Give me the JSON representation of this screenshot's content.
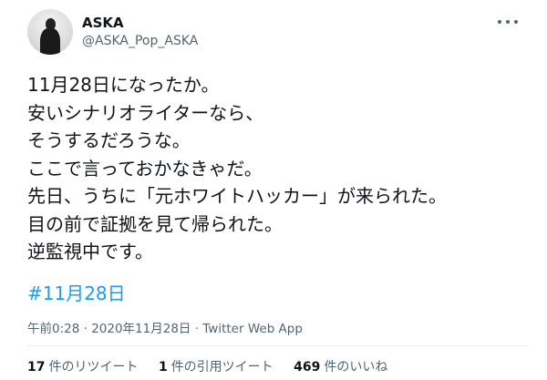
{
  "author": {
    "name": "ASKA",
    "handle": "@ASKA_Pop_ASKA"
  },
  "tweet": {
    "lines": [
      "11月28日になったか。",
      "安いシナリオライターなら、",
      "そうするだろうな。",
      "ここで言っておかなきゃだ。",
      "先日、うちに「元ホワイトハッカー」が来られた。",
      "目の前で証拠を見て帰られた。",
      "逆監視中です。"
    ],
    "hashtag": "#11月28日"
  },
  "meta": {
    "time": "午前0:28",
    "separator1": " · ",
    "date": "2020年11月28日",
    "separator2": " · ",
    "client": "Twitter Web App"
  },
  "stats": {
    "retweets_count": "17",
    "retweets_label": "件のリツイート",
    "quotes_count": "1",
    "quotes_label": "件の引用ツイート",
    "likes_count": "469",
    "likes_label": "件のいいね"
  },
  "colors": {
    "text": "#0f1419",
    "secondary": "#536471",
    "link": "#1d9bf0"
  }
}
